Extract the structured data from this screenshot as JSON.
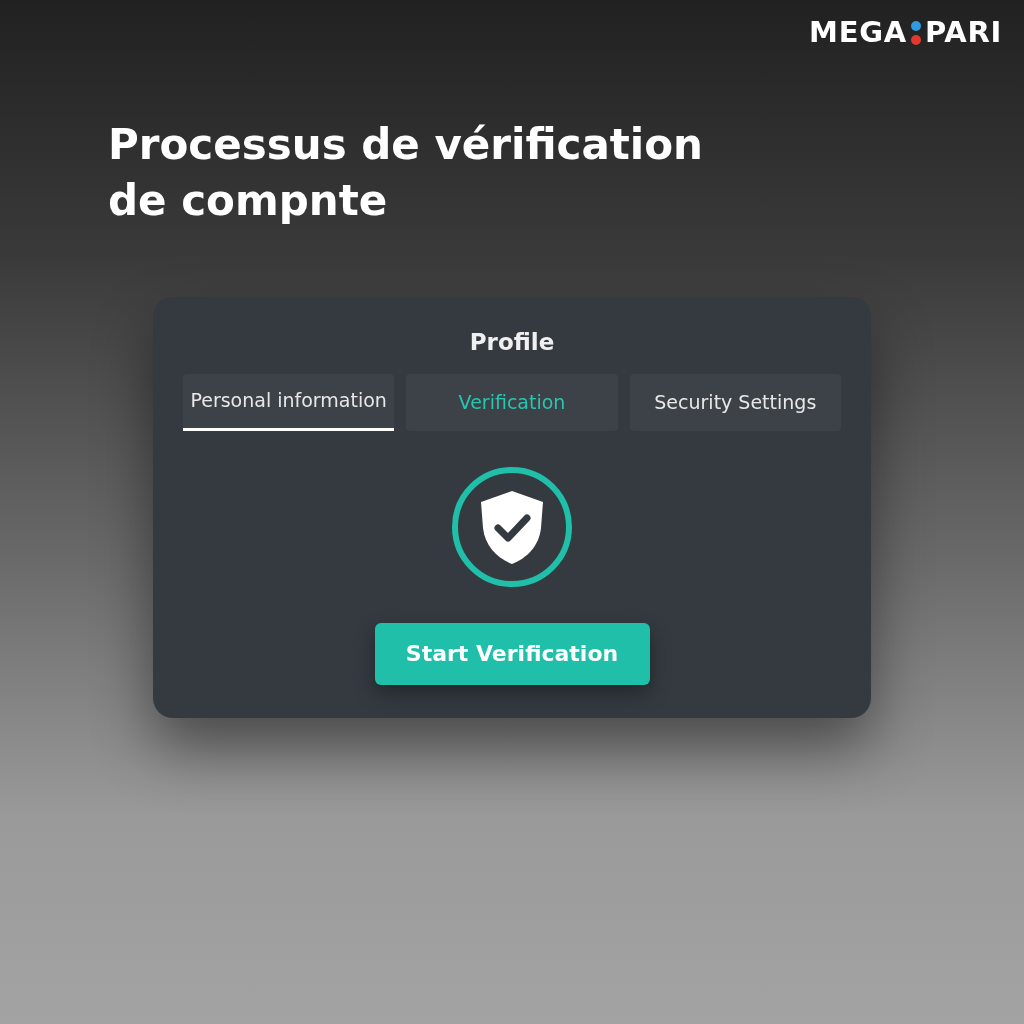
{
  "logo": {
    "left": "MEGA",
    "right": "PARI"
  },
  "headline": "Processus de vérification de compnte",
  "card": {
    "title": "Profile",
    "tabs": [
      {
        "label": "Personal information",
        "selected": true,
        "active": false
      },
      {
        "label": "Verification",
        "selected": false,
        "active": true
      },
      {
        "label": "Security Settings",
        "selected": false,
        "active": false
      }
    ],
    "button": "Start Verification"
  }
}
